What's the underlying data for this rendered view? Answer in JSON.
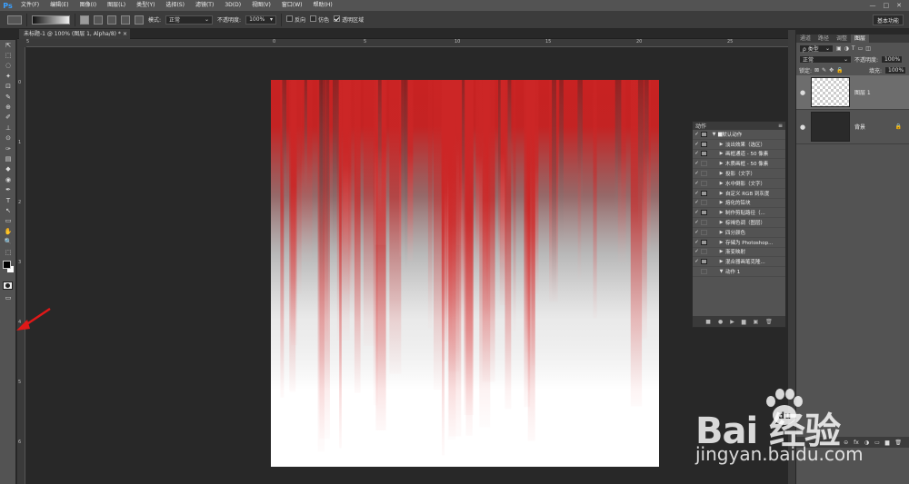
{
  "app": {
    "logo": "Ps",
    "accent": "#3aa0ff"
  },
  "menu": [
    "文件(F)",
    "编辑(E)",
    "图像(I)",
    "图层(L)",
    "类型(Y)",
    "选择(S)",
    "滤镜(T)",
    "3D(D)",
    "视图(V)",
    "窗口(W)",
    "帮助(H)"
  ],
  "window_controls": [
    "—",
    "□",
    "✕"
  ],
  "options": {
    "mode_label": "模式:",
    "mode_value": "正常",
    "opacity_label": "不透明度:",
    "opacity_value": "100%",
    "reverse_label": "反向",
    "dither_label": "仿色",
    "transparency_label": "透明区域",
    "workspace": "基本功能"
  },
  "document": {
    "tab_title": "未标题-1 @ 100% (图层 1, Alpha/8) *",
    "close": "×"
  },
  "ruler": {
    "top": [
      "5",
      "0",
      "5",
      "10",
      "15",
      "20",
      "25"
    ],
    "left": [
      "0",
      "1",
      "2",
      "3",
      "4",
      "5",
      "6"
    ]
  },
  "tools": [
    "⇱",
    "⬚",
    "◌",
    "✦",
    "⊡",
    "✎",
    "⊕",
    "✐",
    "⊥",
    "⊙",
    "✑",
    "▤",
    "◆",
    "◉",
    "✒",
    "T",
    "↖",
    "▭",
    "✋",
    "🔍",
    "⬚"
  ],
  "canvas": {
    "red": "#c82222",
    "fade_to": "#ffffff"
  },
  "actions_panel": {
    "title": "动作",
    "menu": "≡",
    "rows": [
      {
        "check": "✓",
        "dialog": true,
        "tri": "▼",
        "indent": 0,
        "label": "默认动作",
        "folder": true
      },
      {
        "check": "✓",
        "dialog": true,
        "tri": "▶",
        "indent": 1,
        "label": "淡出效果（选区）"
      },
      {
        "check": "✓",
        "dialog": true,
        "tri": "▶",
        "indent": 1,
        "label": "画框通道 - 50 像素"
      },
      {
        "check": "✓",
        "dialog": false,
        "tri": "▶",
        "indent": 1,
        "label": "木质画框 - 50 像素"
      },
      {
        "check": "✓",
        "dialog": false,
        "tri": "▶",
        "indent": 1,
        "label": "投影（文字）"
      },
      {
        "check": "✓",
        "dialog": false,
        "tri": "▶",
        "indent": 1,
        "label": "水中倒影（文字）"
      },
      {
        "check": "✓",
        "dialog": true,
        "tri": "▶",
        "indent": 1,
        "label": "自定义 RGB 到灰度"
      },
      {
        "check": "✓",
        "dialog": false,
        "tri": "▶",
        "indent": 1,
        "label": "熔化的铅块"
      },
      {
        "check": "✓",
        "dialog": true,
        "tri": "▶",
        "indent": 1,
        "label": "制作剪贴路径（..."
      },
      {
        "check": "✓",
        "dialog": false,
        "tri": "▶",
        "indent": 1,
        "label": "棕褐色调（图层）"
      },
      {
        "check": "✓",
        "dialog": false,
        "tri": "▶",
        "indent": 1,
        "label": "四分颜色"
      },
      {
        "check": "✓",
        "dialog": true,
        "tri": "▶",
        "indent": 1,
        "label": "存储为 Photoshop..."
      },
      {
        "check": "✓",
        "dialog": false,
        "tri": "▶",
        "indent": 1,
        "label": "渐变映射"
      },
      {
        "check": "✓",
        "dialog": true,
        "tri": "▶",
        "indent": 1,
        "label": "混合器画笔克隆..."
      },
      {
        "check": "",
        "dialog": false,
        "tri": "▼",
        "indent": 1,
        "label": "动作 1"
      }
    ],
    "footer": [
      "■",
      "●",
      "▶",
      "▆",
      "▣",
      "🗑"
    ]
  },
  "layers_panel": {
    "tabs": [
      "通道",
      "路径",
      "调整",
      "图层"
    ],
    "active_tab": 3,
    "filter_label": "ρ 类型",
    "blend_mode": "正常",
    "opacity_label": "不透明度:",
    "opacity_value": "100%",
    "lock_label": "锁定:",
    "fill_label": "填充:",
    "fill_value": "100%",
    "layers": [
      {
        "name": "图层 1",
        "thumb": "checker",
        "selected": true,
        "eye": "●"
      },
      {
        "name": "背景",
        "thumb": "dark",
        "selected": false,
        "eye": "●",
        "lock": "🔒"
      }
    ],
    "footer": [
      "⊝",
      "fx",
      "◑",
      "▭",
      "▆",
      "🗑"
    ]
  },
  "watermark": {
    "text": "Bai 经验",
    "du": "du",
    "sub": "jingyan.baidu.com"
  }
}
